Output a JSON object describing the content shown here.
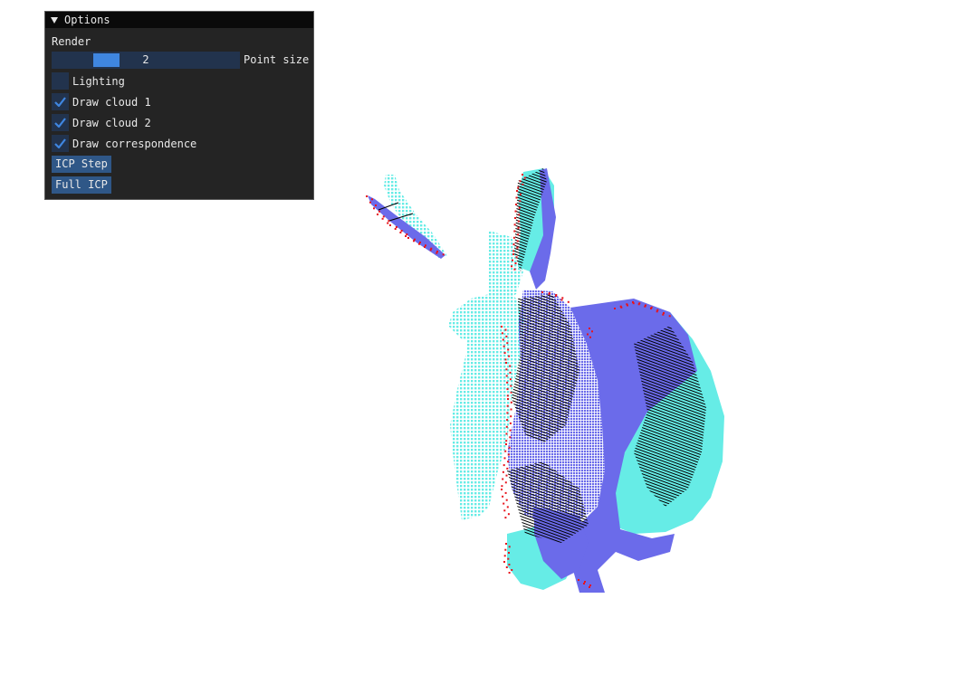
{
  "colors": {
    "cloud_1": "#66ece6",
    "cloud_2": "#6b6bea",
    "correspondence": "#000000",
    "outlier": "#e8131b",
    "window_bg": "#1d1d1d",
    "titlebar_bg": "#0a0a0a",
    "widget_bg": "#22334d",
    "accent": "#3f86e0",
    "button_bg": "#2f5787",
    "text": "#e8e8e8"
  },
  "options_window": {
    "title": "Options",
    "collapse_icon": "triangle-down-icon",
    "section_render": "Render",
    "point_size": {
      "label": "Point size",
      "value": "2",
      "fraction": 0.25
    },
    "checkboxes": [
      {
        "label": "Lighting",
        "checked": false
      },
      {
        "label": "Draw cloud 1",
        "checked": true
      },
      {
        "label": "Draw cloud 2",
        "checked": true
      },
      {
        "label": "Draw correspondence",
        "checked": true
      }
    ],
    "buttons": {
      "icp_step": "ICP Step",
      "full_icp": "Full ICP"
    }
  }
}
